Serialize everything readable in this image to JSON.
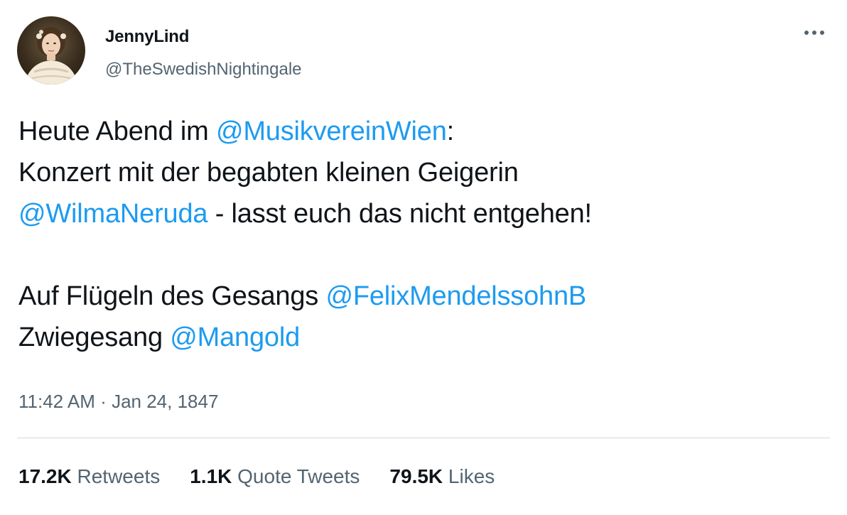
{
  "author": {
    "display_name": "JennyLind",
    "handle": "@TheSwedishNightingale",
    "avatar_icon": "portrait-avatar"
  },
  "menu": {
    "icon": "more-horizontal-icon"
  },
  "tweet": {
    "line1": {
      "text": "Heute Abend im ",
      "mention": "@MusikvereinWien",
      "after": ":"
    },
    "line2": {
      "text": "Konzert mit der begabten kleinen Geigerin"
    },
    "line3": {
      "mention": "@WilmaNeruda",
      "after": " - lasst euch das nicht entgehen!"
    },
    "line4": {
      "text": "Auf Flügeln des Gesangs ",
      "mention": "@FelixMendelssohnB"
    },
    "line5": {
      "text": "Zwiegesang ",
      "mention": "@Mangold"
    }
  },
  "meta": {
    "time": "11:42 AM",
    "separator": "·",
    "date": "Jan 24, 1847"
  },
  "stats": {
    "retweets_count": "17.2K",
    "retweets_label": "Retweets",
    "quotes_count": "1.1K",
    "quotes_label": "Quote Tweets",
    "likes_count": "79.5K",
    "likes_label": "Likes"
  },
  "colors": {
    "text": "#0f1419",
    "secondary": "#536471",
    "link": "#1d9bf0",
    "divider": "#cfd9de"
  }
}
